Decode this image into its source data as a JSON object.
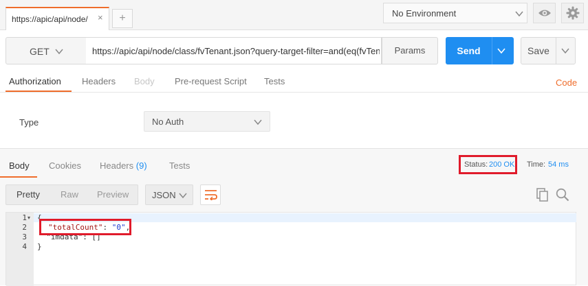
{
  "tabs": {
    "active_label": "https://apic/api/node/",
    "close_glyph": "×",
    "add_glyph": "+"
  },
  "environment": {
    "selected": "No Environment"
  },
  "request": {
    "method": "GET",
    "url": "https://apic/api/node/class/fvTenant.json?query-target-filter=and(eq(fvTenant",
    "params_label": "Params",
    "send_label": "Send",
    "save_label": "Save"
  },
  "request_tabs": [
    {
      "label": "Authorization",
      "state": "active"
    },
    {
      "label": "Headers",
      "state": "normal"
    },
    {
      "label": "Body",
      "state": "disabled"
    },
    {
      "label": "Pre-request Script",
      "state": "normal"
    },
    {
      "label": "Tests",
      "state": "normal"
    }
  ],
  "code_link": "Code",
  "auth": {
    "type_label": "Type",
    "selected": "No Auth"
  },
  "response_tabs": [
    {
      "label": "Body",
      "state": "active"
    },
    {
      "label": "Cookies",
      "state": "normal"
    },
    {
      "label": "Headers",
      "count": "(9)",
      "state": "normal"
    },
    {
      "label": "Tests",
      "state": "normal"
    }
  ],
  "status": {
    "label": "Status:",
    "value": "200 OK"
  },
  "time": {
    "label": "Time:",
    "value": "54 ms"
  },
  "format_options": [
    {
      "label": "Pretty",
      "state": "active"
    },
    {
      "label": "Raw",
      "state": "normal"
    },
    {
      "label": "Preview",
      "state": "normal"
    }
  ],
  "language": "JSON",
  "icons": [
    "eye-icon",
    "gear-icon",
    "chevron-down-icon",
    "wrap-lines-icon",
    "copy-icon",
    "search-icon"
  ],
  "colors": {
    "accent": "#ef6c2a",
    "send": "#1f8ef1",
    "highlight_box": "#e01b2b"
  },
  "editor": {
    "line_numbers": [
      "1",
      "2",
      "3",
      "4"
    ],
    "fold_glyph": "▾",
    "lines": {
      "l1": "{",
      "l2_key": "\"totalCount\"",
      "l2_sep": ": ",
      "l2_val": "\"0\"",
      "l2_end": ",",
      "l3": "  \"imdata\": []",
      "l4": "}"
    }
  }
}
